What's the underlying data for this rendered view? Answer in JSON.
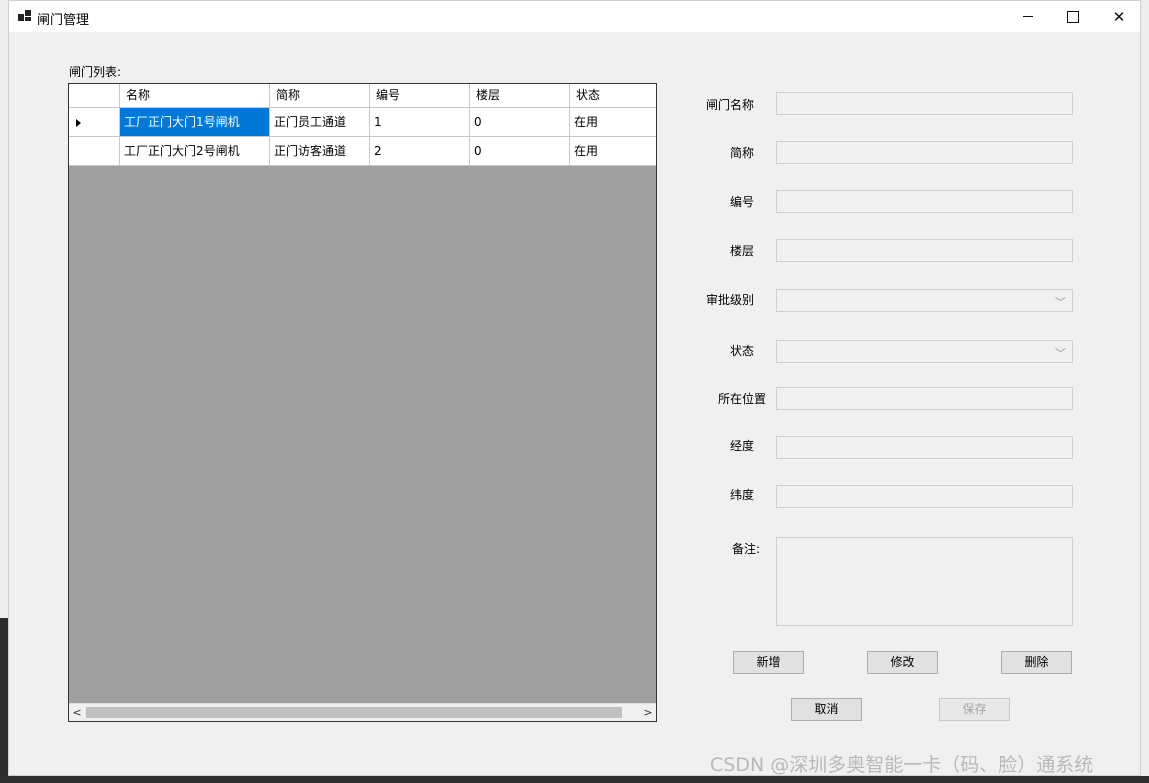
{
  "window": {
    "title": "闸门管理",
    "icons": {
      "app": "window-app-icon",
      "minimize": "minimize-icon",
      "maximize": "maximize-icon",
      "close": "close-icon"
    }
  },
  "list": {
    "label": "闸门列表:",
    "columns": [
      "名称",
      "简称",
      "编号",
      "楼层",
      "状态"
    ],
    "rows": [
      {
        "name": "工厂正门大门1号闸机",
        "short": "正门员工通道",
        "number": "1",
        "floor": "0",
        "status": "在用",
        "selected": true
      },
      {
        "name": "工厂正门大门2号闸机",
        "short": "正门访客通道",
        "number": "2",
        "floor": "0",
        "status": "在用",
        "selected": false
      }
    ],
    "scroll_left": "<",
    "scroll_right": ">"
  },
  "form": {
    "gate_name_label": "闸门名称",
    "short_label": "简称",
    "number_label": "编号",
    "floor_label": "楼层",
    "approval_label": "审批级别",
    "status_label": "状态",
    "location_label": "所在位置",
    "longitude_label": "经度",
    "latitude_label": "纬度",
    "remark_label": "备注:",
    "gate_name_value": "",
    "short_value": "",
    "number_value": "",
    "floor_value": "",
    "approval_value": "",
    "status_value": "",
    "location_value": "",
    "longitude_value": "",
    "latitude_value": "",
    "remark_value": ""
  },
  "buttons": {
    "add": "新增",
    "edit": "修改",
    "delete": "删除",
    "cancel": "取消",
    "save": "保存"
  },
  "watermark": "CSDN @深圳多奥智能一卡（码、脸）通系统"
}
